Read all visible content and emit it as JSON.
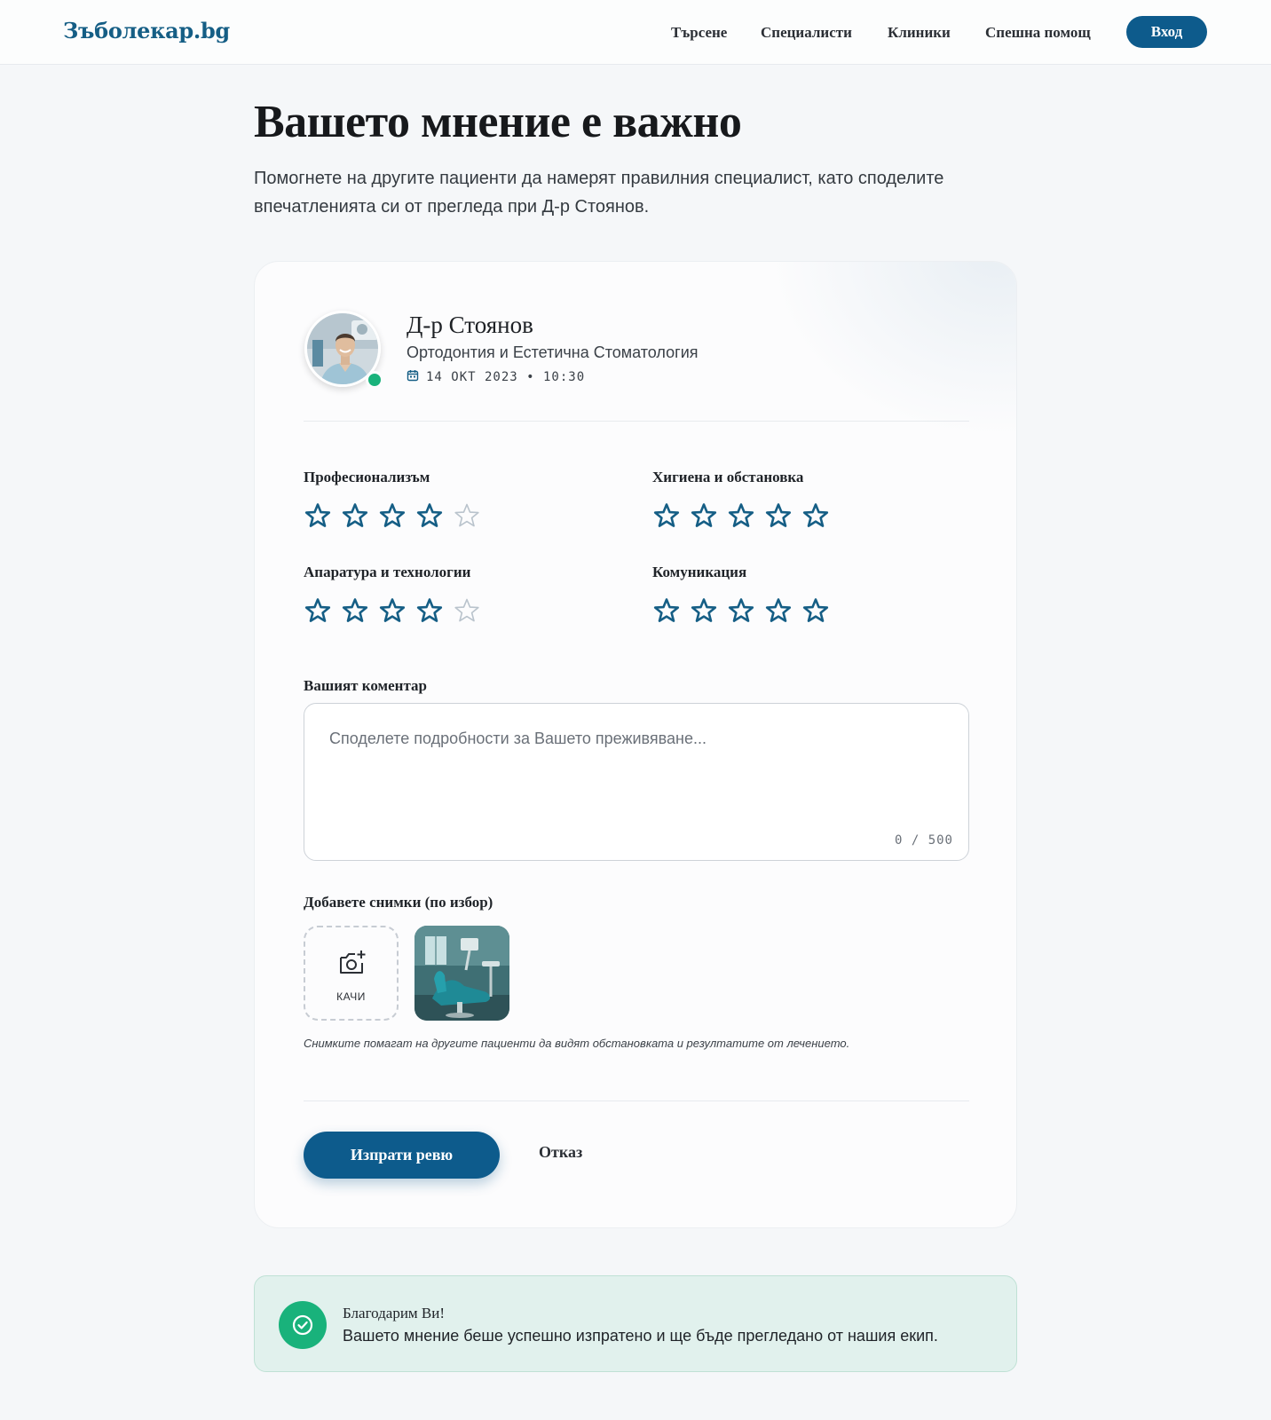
{
  "header": {
    "logo": "Зъболекар.bg",
    "nav": [
      "Търсене",
      "Специалисти",
      "Клиники",
      "Спешна помощ"
    ],
    "login_label": "Вход"
  },
  "page": {
    "title": "Вашето мнение е важно",
    "subtitle": "Помогнете на другите пациенти да намерят правилния специалист, като споделите впечатленията си от прегледа при Д-р Стоянов."
  },
  "doctor": {
    "name": "Д-р Стоянов",
    "specialty": "Ортодонтия и Естетична Стоматология",
    "visit_datetime": "14 ОКТ 2023 • 10:30"
  },
  "ratings": [
    {
      "label": "Професионализъм",
      "value": 4,
      "max": 5
    },
    {
      "label": "Хигиена и обстановка",
      "value": 5,
      "max": 5
    },
    {
      "label": "Апаратура и технологии",
      "value": 4,
      "max": 5
    },
    {
      "label": "Комуникация",
      "value": 5,
      "max": 5
    }
  ],
  "comment": {
    "label": "Вашият коментар",
    "placeholder": "Споделете подробности за Вашето преживяване...",
    "value": "",
    "char_count": "0 / 500"
  },
  "photos": {
    "label": "Добавете снимки (по избор)",
    "upload_label": "КАЧИ",
    "hint": "Снимките помагат на другите пациенти да видят обстановката и резултатите от лечението."
  },
  "actions": {
    "submit_label": "Изпрати ревю",
    "cancel_label": "Отказ"
  },
  "success": {
    "title": "Благодарим Ви!",
    "text": "Вашето мнение беше успешно изпратено и ще бъде прегледано от нашия екип."
  },
  "colors": {
    "brand": "#0d5b8c",
    "star_filled": "#155e85",
    "star_empty": "#b9c3cc",
    "success": "#19b27b"
  },
  "icons": {
    "calendar": "calendar-icon",
    "upload": "camera-plus-icon",
    "star": "star-icon",
    "success": "check-circle-icon"
  }
}
